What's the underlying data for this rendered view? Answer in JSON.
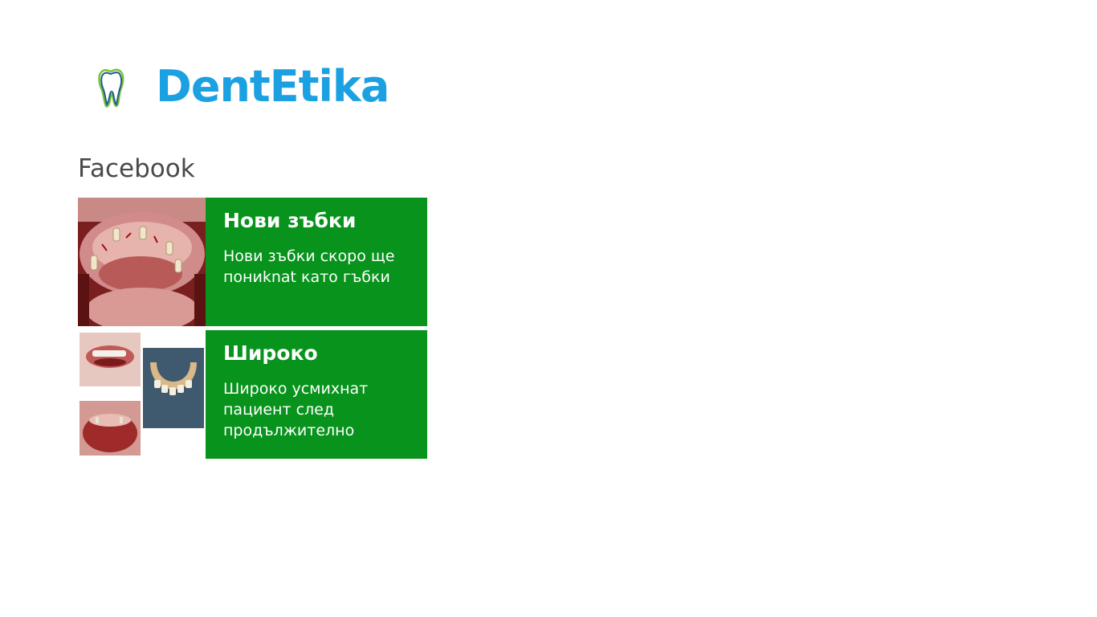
{
  "app": {
    "title": "DentEtika",
    "logo_icon": "tooth-icon"
  },
  "colors": {
    "brand_blue": "#1ba1e2",
    "tile_green": "#07931c",
    "section_title": "#4a4a4a"
  },
  "section": {
    "title": "Facebook"
  },
  "tiles": [
    {
      "title": "Нови зъбки",
      "text": "Нови зъбки скоро ще пониknat като гъбки",
      "image": "dental-implants-photo"
    },
    {
      "title": "Широко",
      "text": "Широко усмихнат пациент след продължително",
      "image": "dental-collage-photo"
    }
  ]
}
